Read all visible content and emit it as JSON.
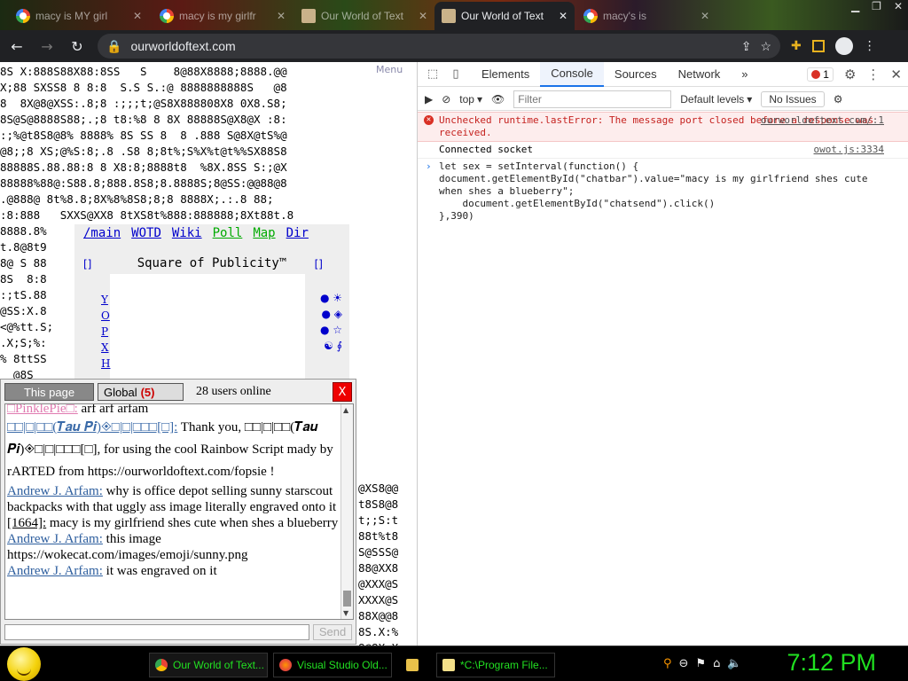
{
  "browser": {
    "tabs": [
      {
        "title": "macy is MY girl",
        "favicon": "google-icon",
        "active": false
      },
      {
        "title": "macy is my girlfr",
        "favicon": "google-icon",
        "active": false
      },
      {
        "title": "Our World of Text",
        "favicon": "owot-icon",
        "active": false
      },
      {
        "title": "Our World of Text",
        "favicon": "owot-icon",
        "active": true
      },
      {
        "title": "macy's is",
        "favicon": "google-icon",
        "active": false
      }
    ],
    "url": "ourworldoftext.com"
  },
  "page": {
    "ascii_lines": [
      "8S X:888S88X88:8SS   S    8@88X8888;8888.@@",
      "X;88 SXSS8 8 8:8  S.S S.:@ 8888888888S   @8",
      "8  8X@8@XSS:.8;8 :;;;t;@S8X888808X8 0X8.S8;",
      "8S@S@8888S88;.;8 t8:%8 8 8X 88888S@X8@X :8:",
      ":;%@t8S8@8% 8888% 8S SS 8  8 .888 S@8X@tS%@",
      "@8;;8 XS;@%S:8;.8 .S8 8;8t%;S%X%t@t%%SX88S8",
      "88888S.88.88:8 8 X8:8;8888t8  %8X.8SS S:;@X",
      "88888%88@:S88.8;888.8S8;8.8888S;8@SS:@@88@8",
      ".@888@ 8t%8.8;8X%8%8S8;8;8 8888X;.:.8 88; ",
      ":8:888   SXXS@XX8 8tXS8t%888:888888;8Xt88t.8",
      "8888.8%",
      "t.8@8t9",
      "8@ S 88",
      "8S  8:8",
      ":;tS.88",
      "@SS:X.8",
      "<@%tt.S;",
      ".X;S;%:",
      "% 8ttSS",
      "  @8S"
    ],
    "menu_label": "Menu",
    "nav_links": [
      "/main",
      "WOTD",
      "Wiki",
      "Poll",
      "Map",
      "Dir"
    ],
    "square_title": "Square of Publicity™",
    "bracket_left": "[]",
    "bracket_right": "[]",
    "vertical_links": [
      "Y",
      "O",
      "P",
      "X",
      "H"
    ],
    "symbols": [
      "● ☀",
      "● ◈",
      "● ☆",
      "☯ ∮"
    ],
    "right_ascii_lines": [
      "@XS8@@",
      "t8S8@8",
      "t;;S:t",
      "88t%t8",
      "S@SSS@",
      "88@XX8",
      "@XXX@S",
      "XXXX@S",
      "88X@@8",
      "8S.X:%",
      "8@8X.X"
    ]
  },
  "chat": {
    "tab_this_page": "This page",
    "tab_global": "Global",
    "global_count": "(5)",
    "online": "28 users online",
    "close": "X",
    "send": "Send",
    "messages": [
      {
        "name": "□PinklePie□:",
        "text": " arf arf arfam"
      },
      {
        "name": "□□|□|□□(𝑻𝒂𝒖 𝑷𝒊)◈□|□|□□□[□]:",
        "text": " Thank you, □□|□|□□(𝑻𝒂𝒖 𝑷𝒊)◈□|□|□□□[□], for using the cool Rainbow Script mady by rARTED from https://ourworldoftext.com/fopsie !"
      },
      {
        "name": "Andrew J. Arfam:",
        "text": " why is office depot selling sunny starscout backpacks with that uggly ass image literally engraved onto it"
      },
      {
        "name": "[1664]:",
        "text": " macy is my girlfriend shes cute when shes a blueberry"
      },
      {
        "name": "Andrew J. Arfam:",
        "text": " this image https://wokecat.com/images/emoji/sunny.png"
      },
      {
        "name": "Andrew J. Arfam:",
        "text": " it was engraved on it"
      }
    ]
  },
  "devtools": {
    "tabs": [
      "Elements",
      "Console",
      "Sources",
      "Network"
    ],
    "more": "»",
    "error_count": "1",
    "context": "top",
    "filter_placeholder": "Filter",
    "levels": "Default levels",
    "issues": "No Issues",
    "error_text": "Unchecked runtime.lastError: The message port closed before a response was received.",
    "error_src": "ourworldoftext.com/:1",
    "log_text": "Connected socket",
    "log_src": "owot.js:3334",
    "code": "let sex = setInterval(function() {\ndocument.getElementById(\"chatbar\").value=\"macy is my girlfriend shes cute when shes a blueberry\";\n    document.getElementById(\"chatsend\").click()\n},390)"
  },
  "taskbar": {
    "tasks": [
      {
        "label": "Our World of Text...",
        "icon": "chrome-icon"
      },
      {
        "label": "Visual Studio Old...",
        "icon": "firefox-icon"
      },
      {
        "label": "",
        "icon": "folder-icon"
      },
      {
        "label": "*C:\\Program File...",
        "icon": "notepad-icon"
      }
    ],
    "clock": "7:12 PM"
  },
  "colors": {
    "chat_name": "#2d5e9e",
    "error_red": "#c5221f",
    "taskbar_text": "#22e022",
    "link_blue": "#0000cc"
  }
}
